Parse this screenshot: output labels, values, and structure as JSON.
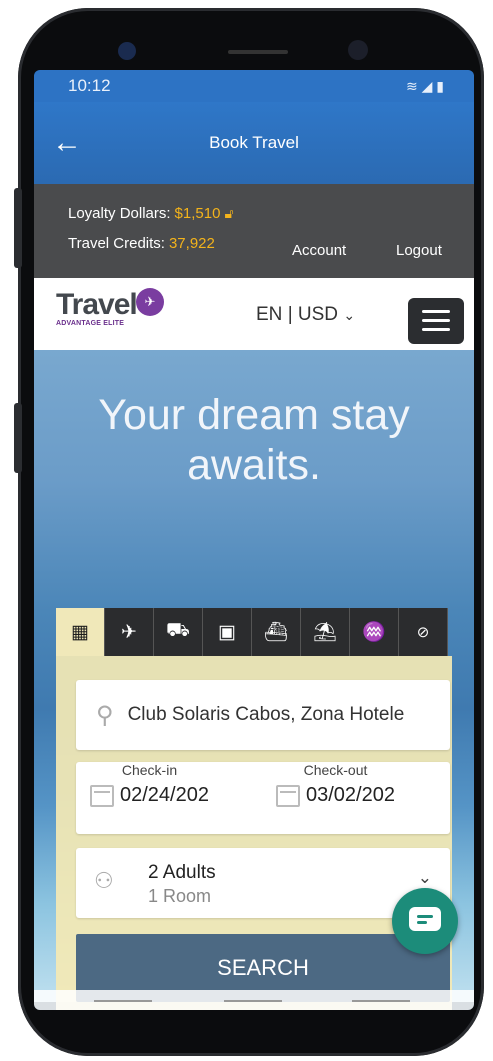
{
  "status_bar": {
    "time": "10:12"
  },
  "app_bar": {
    "title": "Book Travel",
    "back_icon": "arrow-left-icon"
  },
  "loyalty": {
    "loyalty_label": "Loyalty Dollars:",
    "loyalty_value": "$1,510",
    "credits_label": "Travel Credits:",
    "credits_value": "37,922",
    "account_label": "Account",
    "logout_label": "Logout",
    "accent_color": "#f3b31b"
  },
  "brand": {
    "logo_text": "Travel",
    "logo_sub": "ADVANTAGE ELITE",
    "language": "EN",
    "currency": "USD"
  },
  "hero": {
    "headline_line1": "Your dream stay",
    "headline_line2": "awaits."
  },
  "tabs": [
    {
      "name": "hotel",
      "icon": "hotel-icon"
    },
    {
      "name": "flight",
      "icon": "airplane-icon"
    },
    {
      "name": "car",
      "icon": "car-icon"
    },
    {
      "name": "train",
      "icon": "train-icon"
    },
    {
      "name": "cruise",
      "icon": "ship-icon"
    },
    {
      "name": "activities",
      "icon": "beach-umbrella-icon"
    },
    {
      "name": "vacation",
      "icon": "island-icon"
    },
    {
      "name": "deals",
      "icon": "percent-icon"
    }
  ],
  "search_form": {
    "destination": "Club Solaris Cabos, Zona Hotele",
    "checkin_label": "Check-in",
    "checkin_value": "02/24/202",
    "checkout_label": "Check-out",
    "checkout_value": "03/02/202",
    "adults": "2 Adults",
    "rooms": "1 Room",
    "search_label": "SEARCH"
  },
  "colors": {
    "brand_blue": "#2f77c8",
    "search_button": "#4c6983",
    "chat": "#1c8c7a",
    "brand_purple": "#7a3da0"
  }
}
